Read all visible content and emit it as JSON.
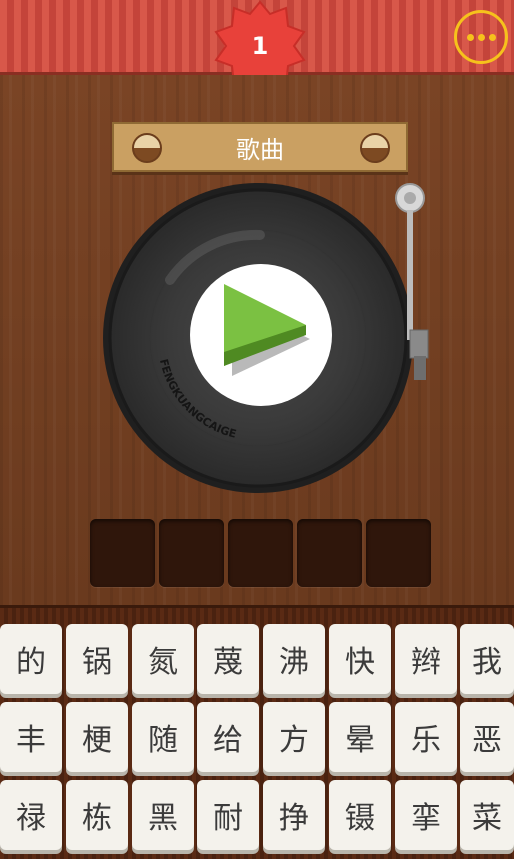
{
  "level": "1",
  "category_label": "歌曲",
  "record_text": "FENGKUANGCAIGE",
  "answer_slot_count": 5,
  "keys": [
    [
      "的",
      "锅",
      "氮",
      "蔑",
      "沸",
      "快",
      "辫",
      "我"
    ],
    [
      "丰",
      "梗",
      "随",
      "给",
      "方",
      "晕",
      "乐",
      "恶"
    ],
    [
      "禄",
      "栋",
      "黑",
      "耐",
      "挣",
      "镊",
      "挛",
      "菜"
    ]
  ],
  "colors": {
    "header_red": "#d8584a",
    "menu_yellow": "#f6c21c",
    "play_green": "#7bc142",
    "wood": "#6b3a1f"
  },
  "icons": {
    "menu": "more-horizontal-icon",
    "play": "play-icon"
  }
}
